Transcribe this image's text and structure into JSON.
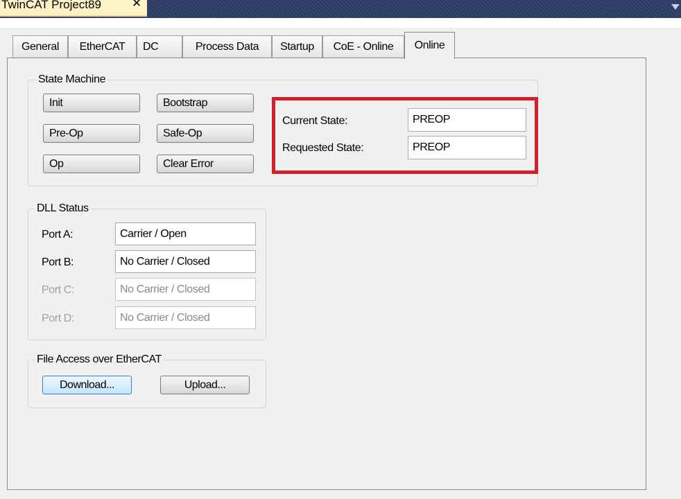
{
  "window": {
    "title": "TwinCAT Project89",
    "close_glyph": "✕"
  },
  "tabs": [
    {
      "label": "General"
    },
    {
      "label": "EtherCAT"
    },
    {
      "label": "DC"
    },
    {
      "label": "Process Data"
    },
    {
      "label": "Startup"
    },
    {
      "label": "CoE - Online"
    },
    {
      "label": "Online",
      "active": true
    }
  ],
  "state_machine": {
    "title": "State Machine",
    "buttons": {
      "init": "Init",
      "bootstrap": "Bootstrap",
      "pre_op": "Pre-Op",
      "safe_op": "Safe-Op",
      "op": "Op",
      "clear_error": "Clear Error"
    },
    "current_state_label": "Current State:",
    "current_state_value": "PREOP",
    "requested_state_label": "Requested State:",
    "requested_state_value": "PREOP"
  },
  "dll_status": {
    "title": "DLL Status",
    "ports": [
      {
        "label": "Port A:",
        "value": "Carrier / Open",
        "enabled": true
      },
      {
        "label": "Port B:",
        "value": "No Carrier / Closed",
        "enabled": true
      },
      {
        "label": "Port C:",
        "value": "No Carrier / Closed",
        "enabled": false
      },
      {
        "label": "Port D:",
        "value": "No Carrier / Closed",
        "enabled": false
      }
    ]
  },
  "file_access": {
    "title": "File Access over EtherCAT",
    "download_label": "Download...",
    "upload_label": "Upload..."
  },
  "colors": {
    "highlight": "#d0202a",
    "title_bar": "#2b3a63",
    "document_tab": "#fdf3c6"
  }
}
